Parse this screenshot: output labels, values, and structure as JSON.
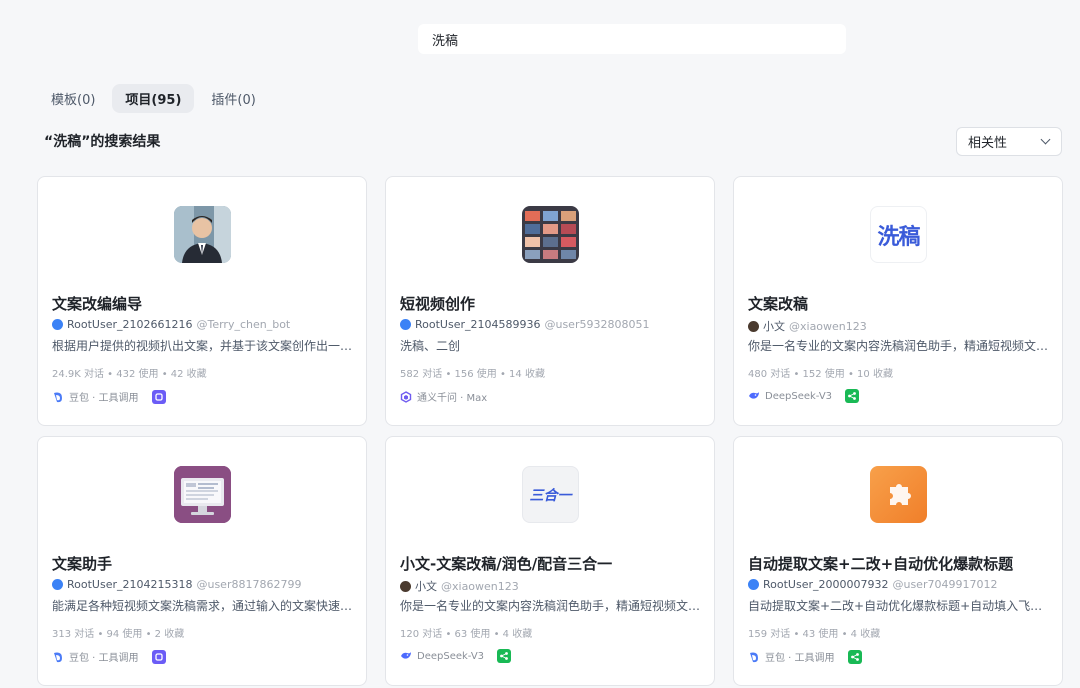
{
  "search": {
    "value": "洗稿"
  },
  "tabs": [
    {
      "label": "模板(0)",
      "active": false
    },
    {
      "label": "项目(95)",
      "active": true
    },
    {
      "label": "插件(0)",
      "active": false
    }
  ],
  "results_title": "“洗稿”的搜索结果",
  "sort": {
    "selected": "相关性"
  },
  "cards": [
    {
      "name": "文案改编编导",
      "author": "RootUser_2102661216",
      "handle": "@Terry_chen_bot",
      "description": "根据用户提供的视频扒出文案，并基于该文案创作出一个新的文案",
      "stats": "24.9K 对话 • 432 使用 • 42 收藏",
      "model": "豆包 · 工具调用",
      "logo_icon": "person-photo",
      "badge_icon": "workflow-badge-icon",
      "badge_color": "#6b5cf6"
    },
    {
      "name": "短视频创作",
      "author": "RootUser_2104589936",
      "handle": "@user5932808051",
      "description": "洗稿、二创",
      "stats": "582 对话 • 156 使用 • 14 收藏",
      "model": "通义千问 · Max",
      "logo_icon": "video-grid-thumbnail",
      "badge_icon": "",
      "badge_color": ""
    },
    {
      "name": "文案改稿",
      "author": "小文",
      "handle": "@xiaowen123",
      "description": "你是一名专业的文案内容洗稿润色助手，精通短视频文案的改写与优化",
      "stats": "480 对话 • 152 使用 • 10 收藏",
      "model": "DeepSeek-V3",
      "logo_text": "洗稿",
      "logo_icon": "text-logo",
      "badge_icon": "share-badge-icon",
      "badge_color": "#19b955"
    },
    {
      "name": "文案助手",
      "author": "RootUser_2104215318",
      "handle": "@user8817862799",
      "description": "能满足各种短视频文案洗稿需求，通过输入的文案快速生成新的文案",
      "stats": "313 对话 • 94 使用 • 2 收藏",
      "model": "豆包 · 工具调用",
      "logo_icon": "monitor-illustration",
      "badge_icon": "workflow-badge-icon",
      "badge_color": "#6b5cf6"
    },
    {
      "name": "小文-文案改稿/润色/配音三合一",
      "author": "小文",
      "handle": "@xiaowen123",
      "description": "你是一名专业的文案内容洗稿润色助手，精通短视频文案的改写与优化",
      "stats": "120 对话 • 63 使用 • 4 收藏",
      "model": "DeepSeek-V3",
      "logo_text": "三合一",
      "logo_icon": "text-logo",
      "badge_icon": "share-badge-icon",
      "badge_color": "#19b955"
    },
    {
      "name": "自动提取文案+二改+自动优化爆款标题",
      "author": "RootUser_2000007932",
      "handle": "@user7049917012",
      "description": "自动提取文案+二改+自动优化爆款标题+自动填入飞书多维表格",
      "stats": "159 对话 • 43 使用 • 4 收藏",
      "model": "豆包 · 工具调用",
      "logo_icon": "puzzle-plugin-icon",
      "badge_icon": "share-badge-icon",
      "badge_color": "#19b955"
    }
  ],
  "colors": {
    "accent_blue": "#3b82f6",
    "page_bg": "#f6f7f9"
  }
}
